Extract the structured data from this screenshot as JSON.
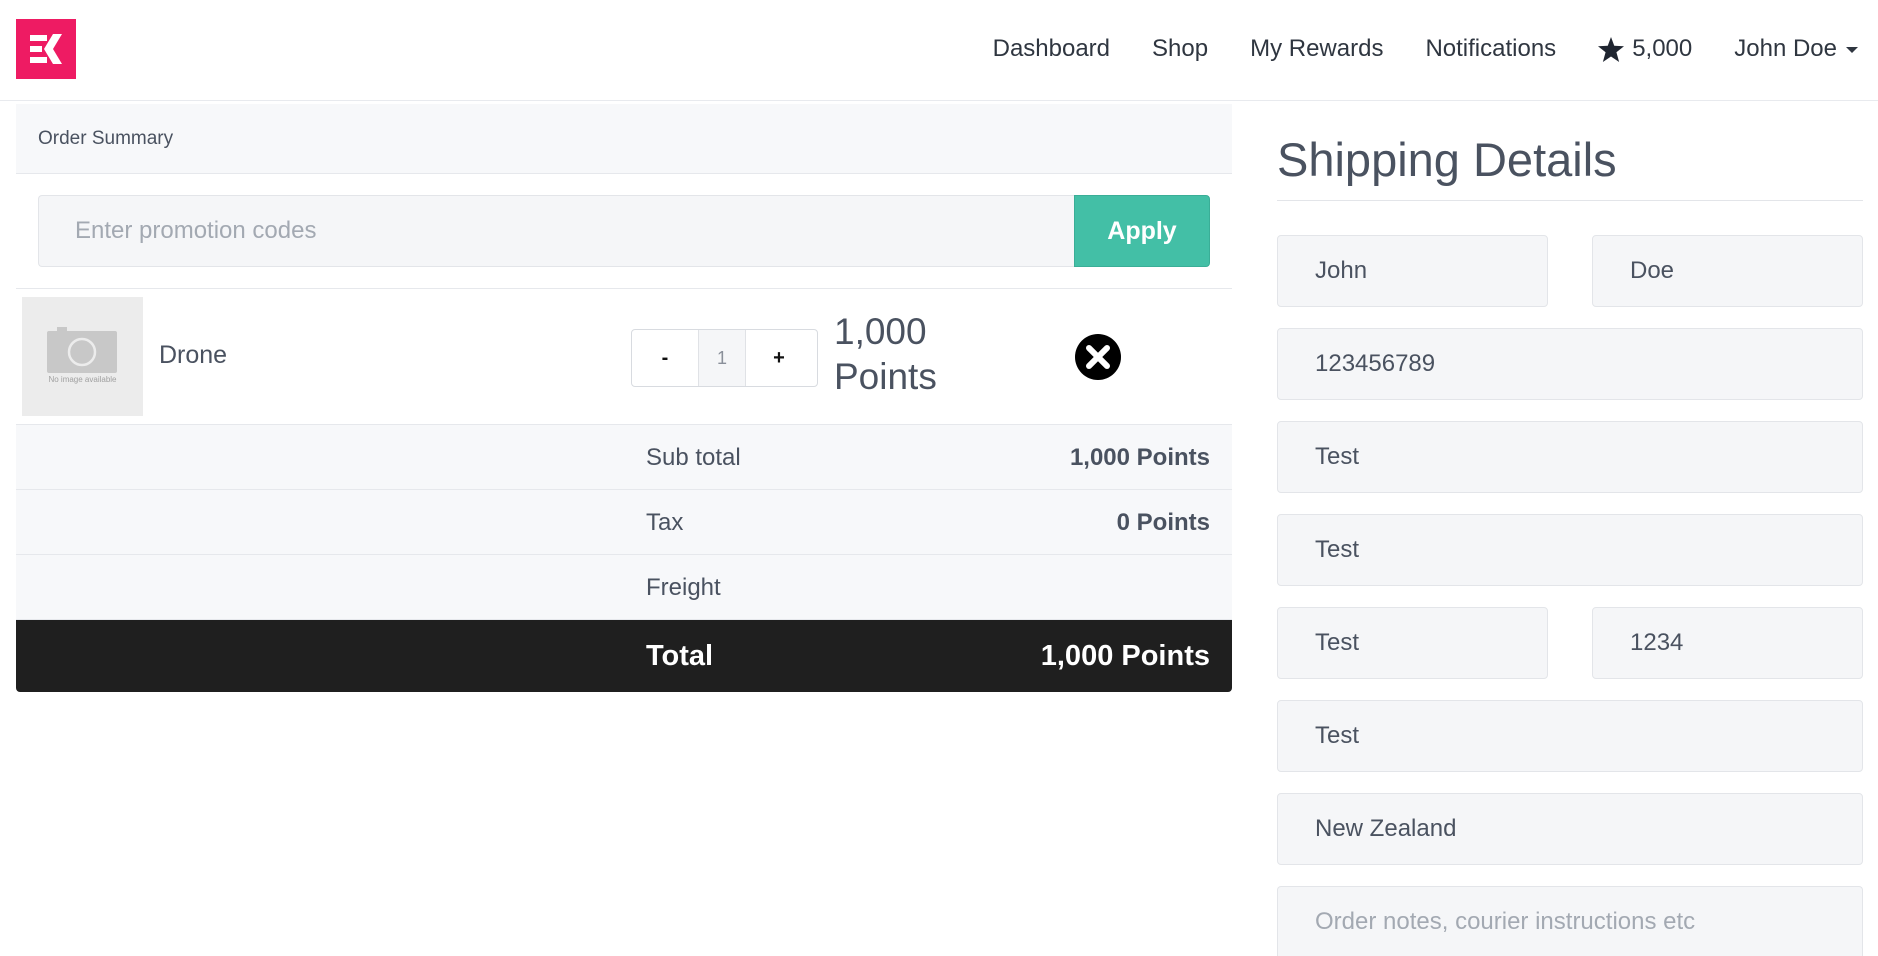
{
  "nav": {
    "items": [
      "Dashboard",
      "Shop",
      "My Rewards",
      "Notifications"
    ],
    "points_balance": "5,000",
    "user_name": "John Doe"
  },
  "order": {
    "header": "Order Summary",
    "promo_placeholder": "Enter promotion codes",
    "apply_label": "Apply",
    "item": {
      "no_image_text": "No image available",
      "name": "Drone",
      "quantity": "1",
      "minus_label": "-",
      "plus_label": "+",
      "price_line1": "1,000",
      "price_line2": "Points"
    },
    "summary": {
      "subtotal_label": "Sub total",
      "subtotal_value": "1,000 Points",
      "tax_label": "Tax",
      "tax_value": "0 Points",
      "freight_label": "Freight",
      "freight_value": "",
      "total_label": "Total",
      "total_value": "1,000 Points"
    }
  },
  "shipping": {
    "title": "Shipping Details",
    "first_name": "John",
    "last_name": "Doe",
    "phone": "123456789",
    "address_line1": "Test",
    "address_line2": "Test",
    "city": "Test",
    "postcode": "1234",
    "region": "Test",
    "country": "New Zealand",
    "notes_placeholder": "Order notes, courier instructions etc",
    "notes_value": ""
  },
  "colors": {
    "brand": "#ee1b63",
    "accent": "#43bfa6",
    "total_bar": "#1f1f1f"
  }
}
